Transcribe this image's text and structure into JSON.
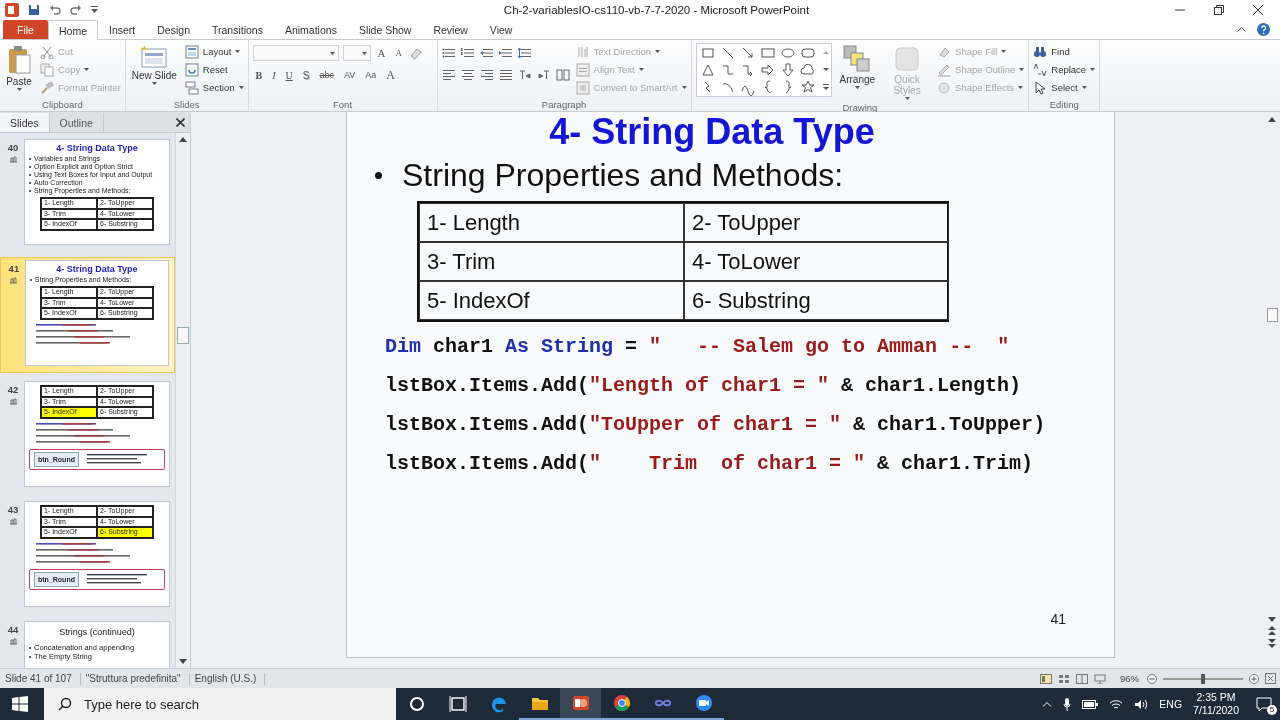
{
  "window": {
    "title": "Ch-2-variablesIO-cs110-vb-7-7-2020  -  Microsoft PowerPoint"
  },
  "file_tab": "File",
  "tabs": [
    {
      "label": "Home",
      "selected": true
    },
    {
      "label": "Insert",
      "selected": false
    },
    {
      "label": "Design",
      "selected": false
    },
    {
      "label": "Transitions",
      "selected": false
    },
    {
      "label": "Animations",
      "selected": false
    },
    {
      "label": "Slide Show",
      "selected": false
    },
    {
      "label": "Review",
      "selected": false
    },
    {
      "label": "View",
      "selected": false
    }
  ],
  "ribbon": {
    "clipboard": {
      "label": "Clipboard",
      "paste": "Paste",
      "items": [
        {
          "label": "Cut",
          "disabled": true,
          "menu": false
        },
        {
          "label": "Copy",
          "disabled": true,
          "menu": true
        },
        {
          "label": "Format Painter",
          "disabled": true,
          "menu": false
        }
      ]
    },
    "slides": {
      "label": "Slides",
      "new_slide": "New Slide",
      "items": [
        {
          "label": "Layout",
          "disabled": false,
          "menu": true
        },
        {
          "label": "Reset",
          "disabled": false,
          "menu": false
        },
        {
          "label": "Section",
          "disabled": false,
          "menu": true
        }
      ]
    },
    "font": {
      "label": "Font",
      "size_buttons": [
        "A",
        "A"
      ],
      "format_buttons": [
        "B",
        "I",
        "U",
        "S",
        "abc",
        "AV",
        "Aa",
        "A"
      ]
    },
    "paragraph": {
      "label": "Paragraph",
      "items": [
        {
          "label": "Text Direction",
          "disabled": true,
          "menu": true
        },
        {
          "label": "Align Text",
          "disabled": true,
          "menu": true
        },
        {
          "label": "Convert to SmartArt",
          "disabled": true,
          "menu": true
        }
      ]
    },
    "drawing": {
      "label": "Drawing",
      "big_buttons": [
        {
          "label": "Arrange",
          "disabled": false
        },
        {
          "label": "Quick Styles",
          "disabled": true
        }
      ],
      "items": [
        {
          "label": "Shape Fill",
          "disabled": true,
          "menu": true
        },
        {
          "label": "Shape Outline",
          "disabled": true,
          "menu": true
        },
        {
          "label": "Shape Effects",
          "disabled": true,
          "menu": true
        }
      ]
    },
    "editing": {
      "label": "Editing",
      "items": [
        {
          "label": "Find",
          "disabled": false,
          "menu": false
        },
        {
          "label": "Replace",
          "disabled": false,
          "menu": true
        },
        {
          "label": "Select",
          "disabled": false,
          "menu": true
        }
      ]
    }
  },
  "slides_pane": {
    "tabs": [
      {
        "label": "Slides",
        "selected": true
      },
      {
        "label": "Outline",
        "selected": false
      }
    ],
    "thumbnails": [
      {
        "number": "40",
        "kind": "content",
        "selected": false,
        "title": "4- String Data Type",
        "bullets": [
          "Variables and Strings",
          "Option Explicit and Option Strict",
          "Using Text Boxes for Input and Output",
          "Auto Correction",
          "String Properties and Methods:"
        ],
        "table": [
          {
            "text": "1- Length",
            "highlighted": false
          },
          {
            "text": "2- ToUpper",
            "highlighted": false
          },
          {
            "text": "3- Trim",
            "highlighted": false
          },
          {
            "text": "4- ToLower",
            "highlighted": false
          },
          {
            "text": "5- IndexOf",
            "highlighted": false
          },
          {
            "text": "6- Substring",
            "highlighted": false
          }
        ]
      },
      {
        "number": "41",
        "kind": "code",
        "selected": true,
        "title": "4- String Data Type",
        "bullets": [
          "String Properties and Methods:"
        ],
        "table": [
          {
            "text": "1- Length",
            "highlighted": false
          },
          {
            "text": "2- ToUpper",
            "highlighted": false
          },
          {
            "text": "3- Trim",
            "highlighted": false
          },
          {
            "text": "4- ToLower",
            "highlighted": false
          },
          {
            "text": "5- IndexOf",
            "highlighted": false
          },
          {
            "text": "6- Substring",
            "highlighted": false
          }
        ]
      },
      {
        "number": "42",
        "kind": "code_form",
        "selected": false,
        "table": [
          {
            "text": "1- Length",
            "highlighted": false
          },
          {
            "text": "2- ToUpper",
            "highlighted": false
          },
          {
            "text": "3- Trim",
            "highlighted": false
          },
          {
            "text": "4- ToLower",
            "highlighted": false
          },
          {
            "text": "5- IndexOf",
            "highlighted": true
          },
          {
            "text": "6- Substring",
            "highlighted": false
          }
        ],
        "form_button": "btn_Round"
      },
      {
        "number": "43",
        "kind": "code_form",
        "selected": false,
        "table": [
          {
            "text": "1- Length",
            "highlighted": false
          },
          {
            "text": "2- ToUpper",
            "highlighted": false
          },
          {
            "text": "3- Trim",
            "highlighted": false
          },
          {
            "text": "4- ToLower",
            "highlighted": false
          },
          {
            "text": "5- IndexOf",
            "highlighted": false
          },
          {
            "text": "6- Substring",
            "highlighted": true
          }
        ],
        "form_button": "btn_Round"
      },
      {
        "number": "44",
        "kind": "text",
        "selected": false,
        "plain_title": "Strings (continued)",
        "bullets": [
          "Concatenation and appending",
          "The Empty String"
        ]
      }
    ]
  },
  "slide": {
    "title": "4- String Data Type",
    "bullet": "String Properties and Methods:",
    "table": [
      [
        "1- Length",
        "2- ToUpper"
      ],
      [
        "3- Trim",
        "4- ToLower"
      ],
      [
        "5- IndexOf",
        "6- Substring"
      ]
    ],
    "code": [
      [
        {
          "kind": "keyword",
          "text": "Dim"
        },
        {
          "kind": "plain",
          "text": " char1 "
        },
        {
          "kind": "keyword",
          "text": "As String"
        },
        {
          "kind": "plain",
          "text": " = "
        },
        {
          "kind": "string",
          "text": "\"   -- Salem go to Amman --  \""
        }
      ],
      [
        {
          "kind": "plain",
          "text": "lstBox.Items.Add("
        },
        {
          "kind": "string",
          "text": "\"Length of char1 = \""
        },
        {
          "kind": "plain",
          "text": " & char1.Length)"
        }
      ],
      [
        {
          "kind": "plain",
          "text": "lstBox.Items.Add("
        },
        {
          "kind": "string",
          "text": "\"ToUpper of char1 = \""
        },
        {
          "kind": "plain",
          "text": " & char1.ToUpper)"
        }
      ],
      [
        {
          "kind": "plain",
          "text": "lstBox.Items.Add("
        },
        {
          "kind": "string",
          "text": "\"    Trim  of char1 = \""
        },
        {
          "kind": "plain",
          "text": " & char1.Trim)"
        }
      ]
    ],
    "page_number": "41"
  },
  "status_bar": {
    "slide_info": "Slide 41 of 107",
    "theme": "\"Struttura predefinita\"",
    "language": "English (U.S.)",
    "zoom": "96%",
    "zoom_slider": {
      "level": 0.5
    }
  },
  "taskbar": {
    "search_placeholder": "Type here to search",
    "apps": [
      {
        "kind": "cortana",
        "running": false,
        "active": false
      },
      {
        "kind": "task_view",
        "running": false,
        "active": false
      },
      {
        "kind": "edge",
        "running": false,
        "active": false
      },
      {
        "kind": "explorer",
        "running": true,
        "active": false
      },
      {
        "kind": "powerpoint",
        "running": true,
        "active": true
      },
      {
        "kind": "chrome",
        "running": true,
        "active": false
      },
      {
        "kind": "infinity",
        "running": true,
        "active": false
      },
      {
        "kind": "video",
        "running": true,
        "active": false
      }
    ],
    "language": "ENG",
    "time": "2:35 PM",
    "date": "7/11/2020",
    "notifications": "5"
  }
}
